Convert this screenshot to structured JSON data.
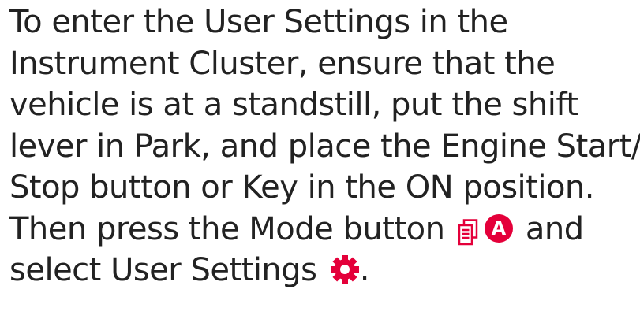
{
  "document": {
    "lines": [
      "To enter the User Settings in the",
      "Instrument Cluster, ensure that the",
      "vehicle is at a standstill, put the shift",
      "lever in Park, and place the Engine Start/",
      "Stop button or Key in the ON position."
    ],
    "line7_before": "Then press the Mode button",
    "badge_label": "A",
    "line7_after": "and",
    "line8_before": "select User Settings",
    "line8_after": "."
  },
  "icons": {
    "mode": "mode-button-icon",
    "settings": "gear-icon"
  },
  "colors": {
    "text": "#222222",
    "accent": "#e4003a"
  }
}
